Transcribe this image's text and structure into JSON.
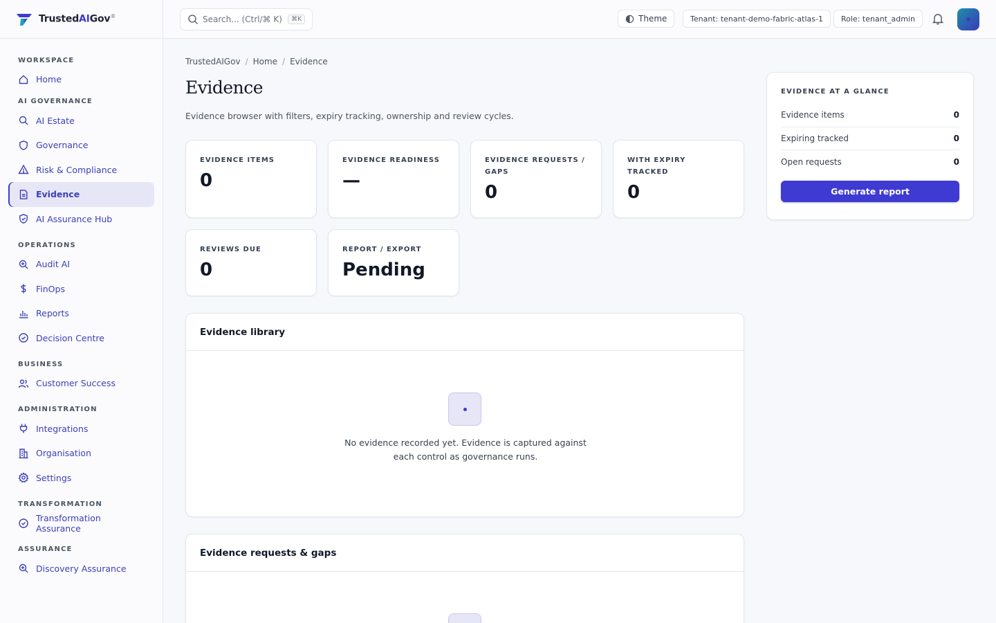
{
  "brand": {
    "name_prefix": "Trusted",
    "name_accent": "AI",
    "name_suffix": "Gov",
    "mark": "®"
  },
  "sidebar": {
    "groups": [
      {
        "heading": "WORKSPACE",
        "items": [
          {
            "label": "Home",
            "icon": "home-icon"
          }
        ]
      },
      {
        "heading": "AI GOVERNANCE",
        "items": [
          {
            "label": "AI Estate",
            "icon": "search-icon"
          },
          {
            "label": "Governance",
            "icon": "shield-icon"
          },
          {
            "label": "Risk & Compliance",
            "icon": "warning-icon"
          },
          {
            "label": "Evidence",
            "icon": "document-icon",
            "active": true
          },
          {
            "label": "AI Assurance Hub",
            "icon": "shield-check-icon"
          }
        ]
      },
      {
        "heading": "OPERATIONS",
        "items": [
          {
            "label": "Audit AI",
            "icon": "zoom-icon"
          },
          {
            "label": "FinOps",
            "icon": "dollar-icon"
          },
          {
            "label": "Reports",
            "icon": "bar-chart-icon"
          },
          {
            "label": "Decision Centre",
            "icon": "check-circle-icon"
          }
        ]
      },
      {
        "heading": "BUSINESS",
        "items": [
          {
            "label": "Customer Success",
            "icon": "users-icon"
          }
        ]
      },
      {
        "heading": "ADMINISTRATION",
        "items": [
          {
            "label": "Integrations",
            "icon": "plug-icon"
          },
          {
            "label": "Organisation",
            "icon": "building-icon"
          },
          {
            "label": "Settings",
            "icon": "gear-icon"
          }
        ]
      },
      {
        "heading": "TRANSFORMATION",
        "items": [
          {
            "label": "Transformation Assurance",
            "icon": "check-circle-icon"
          }
        ]
      },
      {
        "heading": "ASSURANCE",
        "items": [
          {
            "label": "Discovery Assurance",
            "icon": "zoom-icon"
          }
        ]
      }
    ]
  },
  "topbar": {
    "search_placeholder": "Search... (Ctrl/⌘ K)",
    "search_kbd": "⌘K",
    "theme_label": "Theme",
    "tenant_label": "Tenant: tenant-demo-fabric-atlas-1",
    "role_label": "Role: tenant_admin"
  },
  "breadcrumb": [
    "TrustedAIGov",
    "Home",
    "Evidence"
  ],
  "page": {
    "title": "Evidence",
    "subtitle": "Evidence browser with filters, expiry tracking, ownership and review cycles."
  },
  "stats": [
    {
      "label": "EVIDENCE ITEMS",
      "value": "0"
    },
    {
      "label": "EVIDENCE READINESS",
      "value": "—"
    },
    {
      "label": "EVIDENCE REQUESTS / GAPS",
      "value": "0"
    },
    {
      "label": "WITH EXPIRY TRACKED",
      "value": "0"
    },
    {
      "label": "REVIEWS DUE",
      "value": "0"
    },
    {
      "label": "REPORT / EXPORT",
      "value": "Pending"
    }
  ],
  "library": {
    "title": "Evidence library",
    "empty_text": "No evidence recorded yet. Evidence is captured against each control as governance runs."
  },
  "requests": {
    "title": "Evidence requests & gaps"
  },
  "glance": {
    "title": "EVIDENCE AT A GLANCE",
    "rows": [
      {
        "label": "Evidence items",
        "value": "0"
      },
      {
        "label": "Expiring tracked",
        "value": "0"
      },
      {
        "label": "Open requests",
        "value": "0"
      }
    ],
    "button_label": "Generate report"
  },
  "colors": {
    "accent": "#3e3ad2",
    "nav_text": "#3b3fb8",
    "active_bg": "#e7e6f7"
  }
}
